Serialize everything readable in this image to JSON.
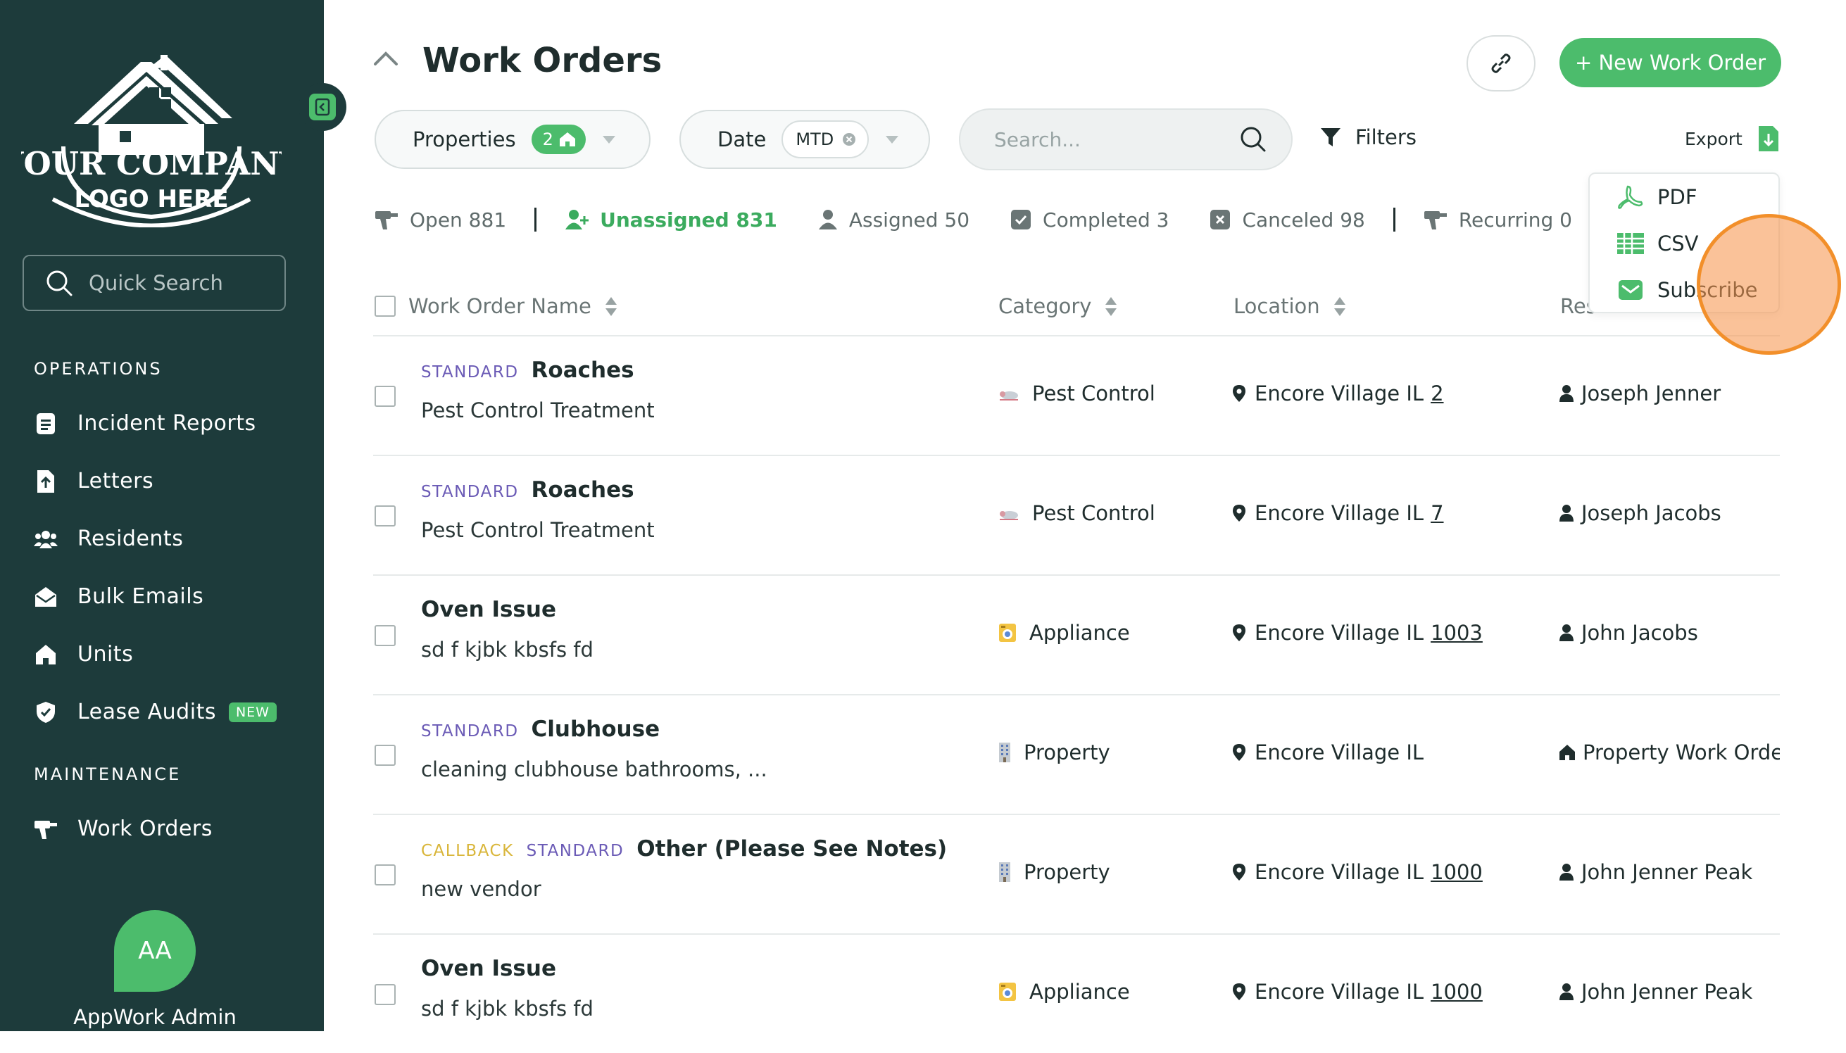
{
  "sidebar": {
    "logo": {
      "line1": "YOUR COMPANY",
      "line2": "LOGO HERE"
    },
    "quick_search_label": "Quick Search",
    "sections": [
      {
        "title": "OPERATIONS",
        "items": [
          {
            "label": "Incident Reports",
            "icon": "document-icon"
          },
          {
            "label": "Letters",
            "icon": "letter-icon"
          },
          {
            "label": "Residents",
            "icon": "people-icon"
          },
          {
            "label": "Bulk Emails",
            "icon": "envelope-icon"
          },
          {
            "label": "Units",
            "icon": "home-icon"
          },
          {
            "label": "Lease Audits",
            "icon": "shield-icon",
            "badge": "NEW"
          }
        ]
      },
      {
        "title": "MAINTENANCE",
        "items": [
          {
            "label": "Work Orders",
            "icon": "drill-icon"
          }
        ]
      }
    ],
    "user": {
      "initials": "AA",
      "name": "AppWork Admin"
    }
  },
  "header": {
    "title": "Work Orders",
    "new_button": "+ New Work Order"
  },
  "filters": {
    "properties": {
      "label": "Properties",
      "count": "2"
    },
    "date": {
      "label": "Date",
      "value": "MTD"
    },
    "search_placeholder": "Search...",
    "filters_label": "Filters",
    "export_label": "Export"
  },
  "status_tabs": [
    {
      "label": "Open 881",
      "icon": "drill-icon",
      "active": false
    },
    {
      "label": "Unassigned 831",
      "icon": "user-plus-icon",
      "active": true
    },
    {
      "label": "Assigned 50",
      "icon": "user-icon",
      "active": false
    },
    {
      "label": "Completed 3",
      "icon": "check-square-icon",
      "active": false
    },
    {
      "label": "Canceled 98",
      "icon": "x-square-icon",
      "active": false
    },
    {
      "label": "Recurring 0",
      "icon": "drill-icon",
      "active": false
    }
  ],
  "table": {
    "columns": [
      "Work Order Name",
      "Category",
      "Location",
      "Res"
    ],
    "rows": [
      {
        "tags": [
          "STANDARD"
        ],
        "title": "Roaches",
        "desc": "Pest Control Treatment",
        "category": "Pest Control",
        "location": "Encore Village IL",
        "unit": "2",
        "resident": "Joseph Jenner"
      },
      {
        "tags": [
          "STANDARD"
        ],
        "title": "Roaches",
        "desc": "Pest Control Treatment",
        "category": "Pest Control",
        "location": "Encore Village IL",
        "unit": "7",
        "resident": "Joseph Jacobs"
      },
      {
        "tags": [],
        "title": "Oven Issue",
        "desc": "sd f kjbk kbsfs fd",
        "category": "Appliance",
        "location": "Encore Village IL",
        "unit": "1003",
        "resident": "John Jacobs"
      },
      {
        "tags": [
          "STANDARD"
        ],
        "title": "Clubhouse",
        "desc": "cleaning clubhouse bathrooms, ...",
        "category": "Property",
        "location": "Encore Village IL",
        "unit": "",
        "resident": "Property Work Order"
      },
      {
        "tags": [
          "CALLBACK",
          "STANDARD"
        ],
        "title": "Other (Please See Notes)",
        "desc": "new vendor",
        "category": "Property",
        "location": "Encore Village IL",
        "unit": "1000",
        "resident": "John Jenner Peak"
      },
      {
        "tags": [],
        "title": "Oven Issue",
        "desc": "sd f kjbk kbsfs fd",
        "category": "Appliance",
        "location": "Encore Village IL",
        "unit": "1000",
        "resident": "John Jenner Peak"
      }
    ]
  },
  "export_menu": {
    "items": [
      {
        "label": "PDF",
        "icon": "pdf-icon"
      },
      {
        "label": "CSV",
        "icon": "spreadsheet-icon"
      },
      {
        "label": "Subscribe",
        "icon": "envelope-icon"
      }
    ]
  },
  "colors": {
    "sidebar_bg": "#1d3b3b",
    "accent_green": "#4cbc6c",
    "tag_standard": "#6b5bb6",
    "tag_callback": "#d9b63a",
    "click_marker": "#f28f2a"
  }
}
